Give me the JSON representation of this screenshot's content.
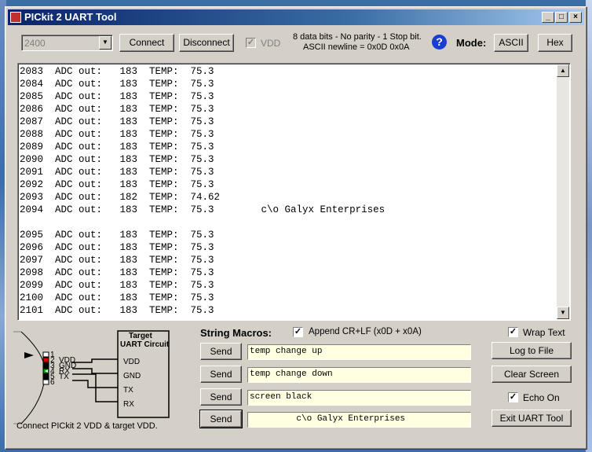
{
  "window": {
    "title": "PICkit 2 UART Tool"
  },
  "toolbar": {
    "baud_value": "2400",
    "connect_label": "Connect",
    "disconnect_label": "Disconnect",
    "vdd_label": "VDD",
    "format_line1": "8 data bits - No parity - 1 Stop bit.",
    "format_line2": "ASCII newline = 0x0D 0x0A",
    "help_glyph": "?",
    "mode_label": "Mode:",
    "ascii_label": "ASCII",
    "hex_label": "Hex"
  },
  "terminal": {
    "lines": [
      "2083  ADC out:   183  TEMP:  75.3",
      "2084  ADC out:   183  TEMP:  75.3",
      "2085  ADC out:   183  TEMP:  75.3",
      "2086  ADC out:   183  TEMP:  75.3",
      "2087  ADC out:   183  TEMP:  75.3",
      "2088  ADC out:   183  TEMP:  75.3",
      "2089  ADC out:   183  TEMP:  75.3",
      "2090  ADC out:   183  TEMP:  75.3",
      "2091  ADC out:   183  TEMP:  75.3",
      "2092  ADC out:   183  TEMP:  75.3",
      "2093  ADC out:   182  TEMP:  74.62",
      "2094  ADC out:   183  TEMP:  75.3        c\\o Galyx Enterprises",
      "",
      "2095  ADC out:   183  TEMP:  75.3",
      "2096  ADC out:   183  TEMP:  75.3",
      "2097  ADC out:   183  TEMP:  75.3",
      "2098  ADC out:   183  TEMP:  75.3",
      "2099  ADC out:   183  TEMP:  75.3",
      "2100  ADC out:   183  TEMP:  75.3",
      "2101  ADC out:   183  TEMP:  75.3"
    ]
  },
  "diagram": {
    "target_title_1": "Target",
    "target_title_2": "UART Circuit",
    "target_pins": [
      "VDD",
      "GND",
      "TX",
      "RX"
    ],
    "pin_numbers": [
      "1",
      "2",
      "3",
      "4",
      "5",
      "6"
    ],
    "pin_names": [
      "VDD",
      "GND",
      "RX",
      "TX"
    ],
    "note": "Connect PICkit 2 VDD & target VDD."
  },
  "macros": {
    "header": "String Macros:",
    "append_label": "Append CR+LF (x0D + x0A)",
    "send_label": "Send",
    "strings": [
      "temp change up",
      "temp change down",
      "screen black",
      "         c\\o Galyx Enterprises"
    ]
  },
  "right_panel": {
    "wrap_label": "Wrap Text",
    "log_label": "Log to File",
    "clear_label": "Clear Screen",
    "echo_label": "Echo On",
    "exit_label": "Exit UART Tool"
  }
}
